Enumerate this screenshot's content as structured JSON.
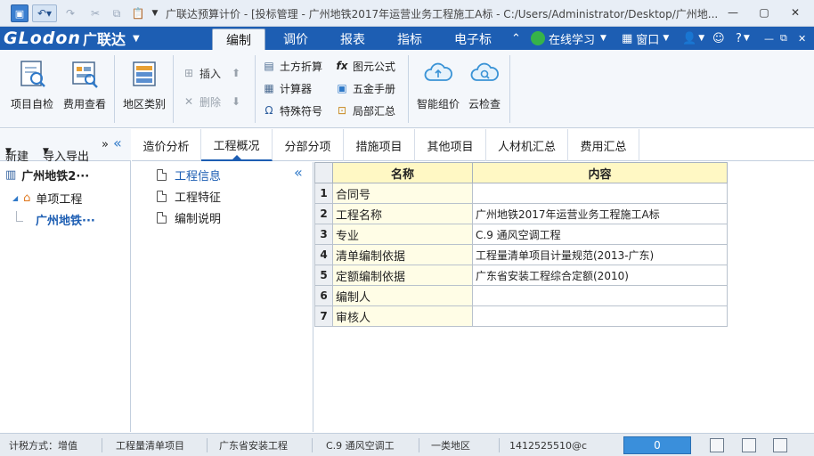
{
  "titlebar": {
    "title": "广联达预算计价 - [投标管理 - 广州地铁2017年运营业务工程施工A标 - C:/Users/Administrator/Desktop/广州地..."
  },
  "menubar": {
    "brand": "GLodon",
    "brand_cn": "广联达",
    "tabs": [
      "编制",
      "调价",
      "报表",
      "指标",
      "电子标"
    ],
    "active_tab": "编制",
    "online_learning": "在线学习",
    "window_menu": "窗口",
    "help": "?"
  },
  "ribbon": {
    "project_check": "项目自检",
    "fee_view": "费用查看",
    "region_category": "地区类别",
    "insert": "插入",
    "delete": "删除",
    "earthwork": "土方折算",
    "calculator": "计算器",
    "special_symbol": "特殊符号",
    "element_formula": "图元公式",
    "hardware_manual": "五金手册",
    "partial_summary": "局部汇总",
    "smart_pricing": "智能组价",
    "cloud_check": "云检查"
  },
  "left": {
    "new_label": "新建",
    "import_export": "导入导出",
    "more": "»",
    "collapse": "«",
    "tree": {
      "root": "广州地铁2···",
      "unit": "单项工程",
      "leaf": "广州地铁···"
    }
  },
  "content_tabs": [
    "造价分析",
    "工程概况",
    "分部分项",
    "措施项目",
    "其他项目",
    "人材机汇总",
    "费用汇总"
  ],
  "active_content_tab": "工程概况",
  "subnav": {
    "items": [
      "工程信息",
      "工程特征",
      "编制说明"
    ],
    "selected": "工程信息",
    "collapse": "«"
  },
  "grid": {
    "headers": [
      "名称",
      "内容"
    ],
    "rows": [
      {
        "no": "1",
        "name": "合同号",
        "value": ""
      },
      {
        "no": "2",
        "name": "工程名称",
        "value": "广州地铁2017年运营业务工程施工A标"
      },
      {
        "no": "3",
        "name": "专业",
        "value": "C.9 通风空调工程"
      },
      {
        "no": "4",
        "name": "清单编制依据",
        "value": "工程量清单项目计量规范(2013-广东)"
      },
      {
        "no": "5",
        "name": "定额编制依据",
        "value": "广东省安装工程综合定额(2010)"
      },
      {
        "no": "6",
        "name": "编制人",
        "value": ""
      },
      {
        "no": "7",
        "name": "审核人",
        "value": ""
      }
    ]
  },
  "statusbar": {
    "tax_mode": "计税方式：增值",
    "bill_type": "工程量清单项目",
    "province": "广东省安装工程",
    "specialty": "C.9 通风空调工",
    "region": "一类地区",
    "user": "1412525510@c",
    "count": "0"
  },
  "colors": {
    "menubar_bg": "#1d5eb3",
    "header_yellow": "#fff8c4",
    "selected_blue": "#1d5eb3",
    "count_bg": "#3a8fdb"
  }
}
